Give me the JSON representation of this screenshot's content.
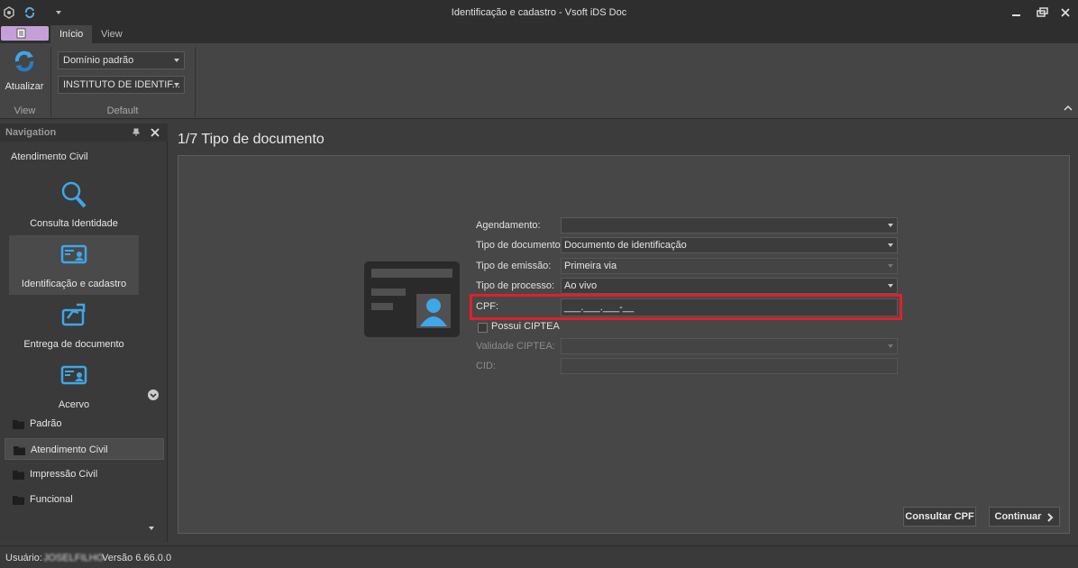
{
  "window": {
    "title": "Identificação e cadastro - Vsoft iDS Doc"
  },
  "ribbon": {
    "tabs": [
      "Início",
      "View"
    ],
    "refresh_label": "Atualizar",
    "groups": [
      "View",
      "Default"
    ],
    "domain_combo": "Domínio padrão",
    "institute_combo": "INSTITUTO DE IDENTIF..."
  },
  "navigation": {
    "header": "Navigation",
    "section": "Atendimento Civil",
    "items": [
      {
        "label": "Consulta Identidade",
        "icon": "search-icon"
      },
      {
        "label": "Identificação e cadastro",
        "icon": "id-card-icon"
      },
      {
        "label": "Entrega de documento",
        "icon": "delivery-icon"
      },
      {
        "label": "Acervo",
        "icon": "archive-card-icon"
      }
    ],
    "groups": [
      "Padrão",
      "Atendimento Civil",
      "Impressão Civil",
      "Funcional"
    ]
  },
  "main": {
    "step_title": "1/7 Tipo de documento",
    "form": {
      "agendamento_label": "Agendamento:",
      "agendamento_value": "",
      "tipo_documento_label": "Tipo de documento:",
      "tipo_documento_value": "Documento de identificação",
      "tipo_emissao_label": "Tipo de emissão:",
      "tipo_emissao_value": "Primeira via",
      "tipo_processo_label": "Tipo de processo:",
      "tipo_processo_value": "Ao vivo",
      "cpf_label": "CPF:",
      "cpf_value": "___.___.___-__",
      "ciptea_label": "Possui CIPTEA",
      "validade_label": "Validade CIPTEA:",
      "validade_value": "",
      "cid_label": "CID:",
      "cid_value": ""
    },
    "buttons": {
      "consultar": "Consultar CPF",
      "continuar": "Continuar"
    }
  },
  "status": {
    "user_label": "Usuário:",
    "user_value": "JOSELFILHO",
    "version": "Versão 6.66.0.0"
  },
  "colors": {
    "accent_blue": "#3fa6e8",
    "highlight_red": "#e0202a",
    "app_tab": "#c5a0d8"
  }
}
